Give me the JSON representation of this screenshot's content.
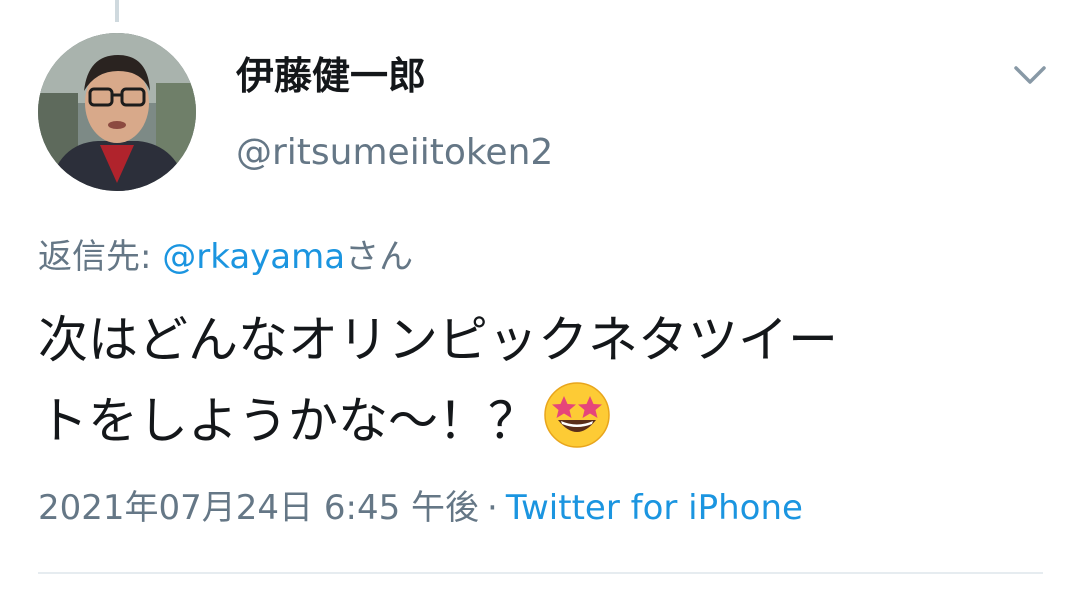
{
  "tweet": {
    "author": {
      "display_name": "伊藤健一郎",
      "handle": "@ritsumeiitoken2",
      "avatar_icon": "profile-photo"
    },
    "reply_prefix": "返信先: ",
    "reply_to": "@rkayama",
    "reply_suffix": "さん",
    "text_line1": "次はどんなオリンピックネタツイー",
    "text_line2": "トをしようかな〜！？",
    "emoji": "star-struck-emoji",
    "timestamp": "2021年07月24日 6:45 午後",
    "separator": "·",
    "source": "Twitter for iPhone",
    "menu_icon": "chevron-down-icon"
  },
  "colors": {
    "text_primary": "#14171a",
    "text_secondary": "#657786",
    "link": "#1b95e0",
    "thread_line": "#cfd9de",
    "divider": "#e6ecf0"
  }
}
